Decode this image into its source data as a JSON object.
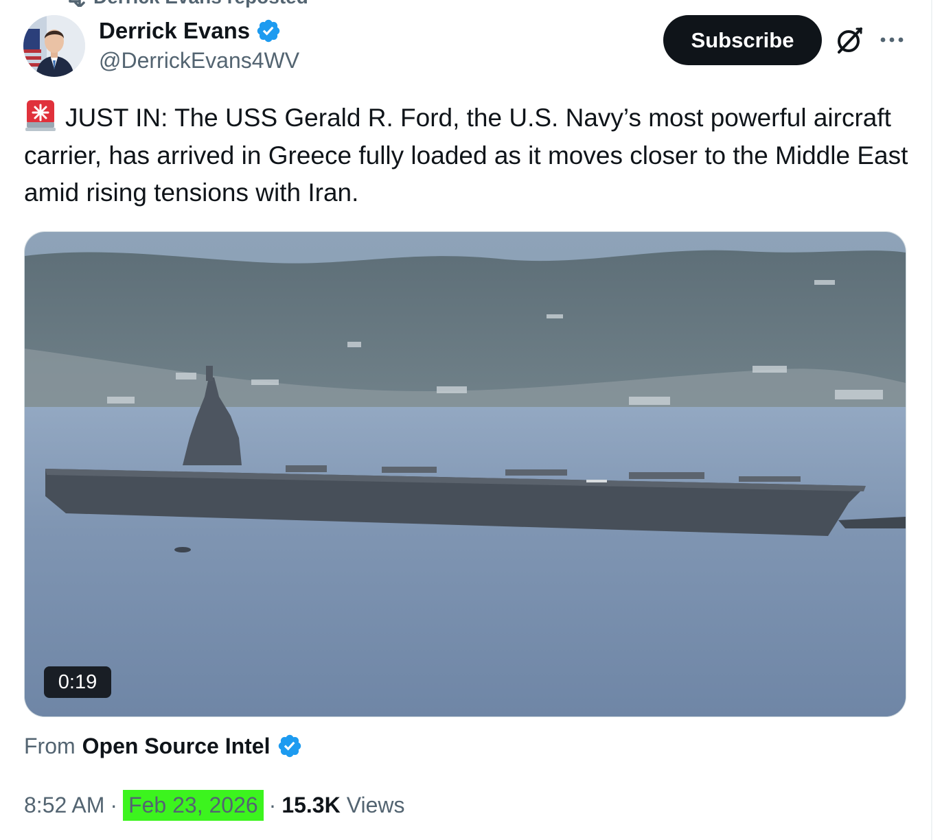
{
  "repost": {
    "label": "Derrick Evans reposted"
  },
  "author": {
    "display_name": "Derrick Evans",
    "handle": "@DerrickEvans4WV",
    "verified": true
  },
  "header_actions": {
    "subscribe_label": "Subscribe",
    "grok_icon": "grok-slash-circle-icon",
    "more_icon": "more-horizontal-icon"
  },
  "tweet": {
    "emoji": "rotating-light-emoji",
    "text": "JUST IN: The USS Gerald R. Ford, the U.S. Navy’s most powerful aircraft carrier, has arrived in Greece fully loaded as it moves closer to the Middle East amid rising tensions with Iran."
  },
  "media": {
    "kind": "video",
    "duration": "0:19"
  },
  "source": {
    "prefix": "From",
    "name": "Open Source Intel",
    "verified": true
  },
  "meta": {
    "time": "8:52 AM",
    "separator": "·",
    "date": "Feb 23, 2026",
    "views_count": "15.3K",
    "views_label": "Views"
  },
  "colors": {
    "text_primary": "#0f1419",
    "text_secondary": "#536471",
    "verified_blue": "#1d9bf0",
    "date_highlight": "#3cf41e",
    "subscribe_bg": "#0f1419"
  }
}
